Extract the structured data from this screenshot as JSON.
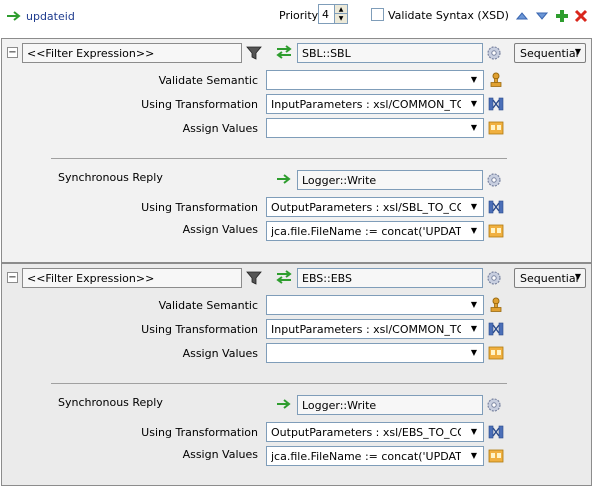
{
  "top": {
    "operation": "updateid",
    "priority_label": "Priority",
    "priority_value": "4",
    "validate_syntax_label": "Validate Syntax (XSD)"
  },
  "rules": [
    {
      "filter": "<<Filter Expression>>",
      "target": "SBL::SBL",
      "execution": "Sequential",
      "validate_semantic_label": "Validate Semantic",
      "validate_semantic_value": "",
      "using_transformation_label": "Using Transformation",
      "using_transformation_value": "InputParameters : xsl/COMMON_TO_...",
      "assign_values_label": "Assign Values",
      "assign_values_value": "",
      "sync_reply_label": "Synchronous Reply",
      "sync_reply_target": "Logger::Write",
      "reply_transformation_label": "Using Transformation",
      "reply_transformation_value": "OutputParameters : xsl/SBL_TO_COM...",
      "reply_assign_label": "Assign Values",
      "reply_assign_value": "jca.file.FileName := concat('UPDATEI..."
    },
    {
      "filter": "<<Filter Expression>>",
      "target": "EBS::EBS",
      "execution": "Sequential",
      "validate_semantic_label": "Validate Semantic",
      "validate_semantic_value": "",
      "using_transformation_label": "Using Transformation",
      "using_transformation_value": "InputParameters : xsl/COMMON_TO_...",
      "assign_values_label": "Assign Values",
      "assign_values_value": "",
      "sync_reply_label": "Synchronous Reply",
      "sync_reply_target": "Logger::Write",
      "reply_transformation_label": "Using Transformation",
      "reply_transformation_value": "OutputParameters : xsl/EBS_TO_COM...",
      "reply_assign_label": "Assign Values",
      "reply_assign_value": "jca.file.FileName := concat('UPDATEI..."
    }
  ],
  "colors": {
    "link_blue": "#1f3c8f",
    "arrow_green": "#2e9d2e",
    "delete_red": "#d9261c",
    "panel1_bg": "#f2f2f2",
    "panel2_bg": "#ebebeb"
  }
}
